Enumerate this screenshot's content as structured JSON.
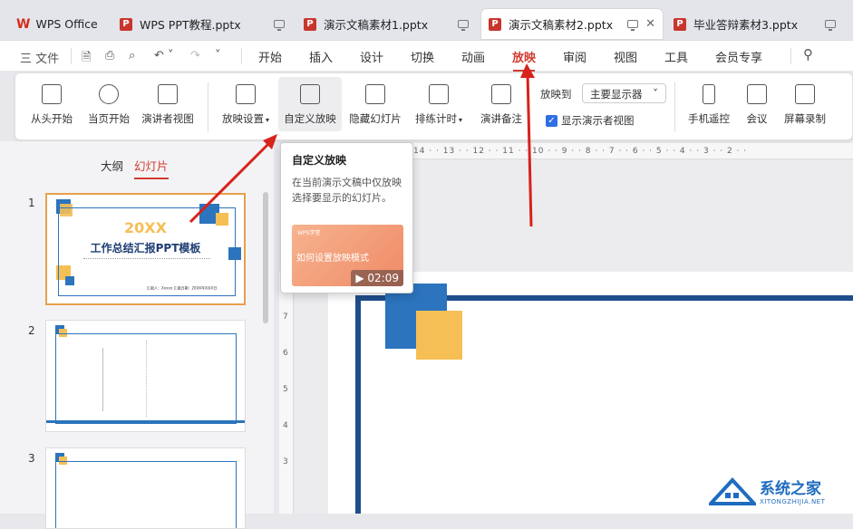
{
  "tabs": [
    {
      "label": "WPS Office",
      "logo": "W"
    },
    {
      "label": "WPS PPT教程.pptx",
      "logo": "P"
    },
    {
      "label": "演示文稿素材1.pptx",
      "logo": "P"
    },
    {
      "label": "演示文稿素材2.pptx",
      "logo": "P",
      "active": true
    },
    {
      "label": "毕业答辩素材3.pptx",
      "logo": "P"
    }
  ],
  "menu": {
    "file": "三 文件",
    "items": [
      "开始",
      "插入",
      "设计",
      "切换",
      "动画",
      "放映",
      "审阅",
      "视图",
      "工具",
      "会员专享"
    ],
    "active": "放映"
  },
  "ribbon": {
    "from_start": "从头开始",
    "from_current": "当页开始",
    "presenter_view": "演讲者视图",
    "show_settings": "放映设置",
    "custom_show": "自定义放映",
    "hide_slide": "隐藏幻灯片",
    "rehearse": "排练计时",
    "speaker_notes": "演讲备注",
    "show_to_label": "放映到",
    "show_to_value": "主要显示器",
    "presenter_checkbox": "显示演示者视图",
    "phone_remote": "手机遥控",
    "meeting": "会议",
    "screen_record": "屏幕录制"
  },
  "tooltip": {
    "title": "自定义放映",
    "desc": "在当前演示文稿中仅放映选择要显示的幻灯片。",
    "thumb_small": "WPS学堂",
    "thumb_text": "如何设置放映模式",
    "duration": "02:09"
  },
  "sidebar": {
    "tab_outline": "大纲",
    "tab_slides": "幻灯片",
    "slides": [
      {
        "num": "1",
        "title": "20XX",
        "subtitle": "工作总结汇报PPT模板",
        "reporter": "汇报人：Xxxxx  汇报日期：20XX年X月X日"
      },
      {
        "num": "2"
      },
      {
        "num": "3"
      }
    ]
  },
  "ruler": "14 · · 13 · · 12 · · 11 · · 10 · · 9 · · 8 · · 7 · · 6 · · 5 · · 4 · · 3 · · 2 · ·",
  "ruler_v": [
    "7",
    "6",
    "5",
    "4",
    "3"
  ],
  "watermark": {
    "cn": "系统之家",
    "en": "XITONGZHIJIA.NET"
  },
  "colors": {
    "accent": "#d03a2f",
    "blue": "#2c74bd",
    "yellow": "#f5bf55",
    "arrow": "#d8221c"
  }
}
